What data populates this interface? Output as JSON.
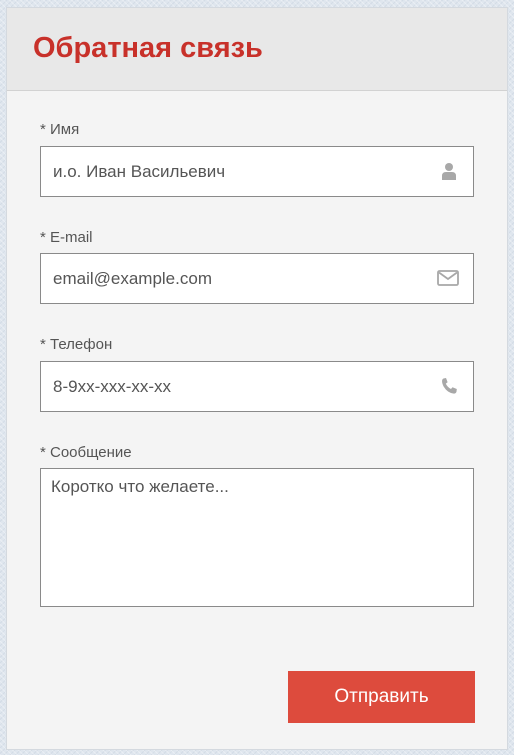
{
  "form": {
    "title": "Обратная связь",
    "fields": [
      {
        "label": "* Имя",
        "placeholder": "и.о. Иван Васильевич",
        "icon": "user-icon"
      },
      {
        "label": "* E-mail",
        "placeholder": "email@example.com",
        "icon": "envelope-icon"
      },
      {
        "label": "* Телефон",
        "placeholder": "8-9xx-xxx-xx-xx",
        "icon": "phone-icon"
      }
    ],
    "message": {
      "label": "* Сообщение",
      "placeholder": "Коротко что желаете..."
    },
    "submit_label": "Отправить"
  },
  "colors": {
    "title": "#c8312a",
    "button": "#dd4b3d",
    "icon": "#a8a8a8"
  }
}
